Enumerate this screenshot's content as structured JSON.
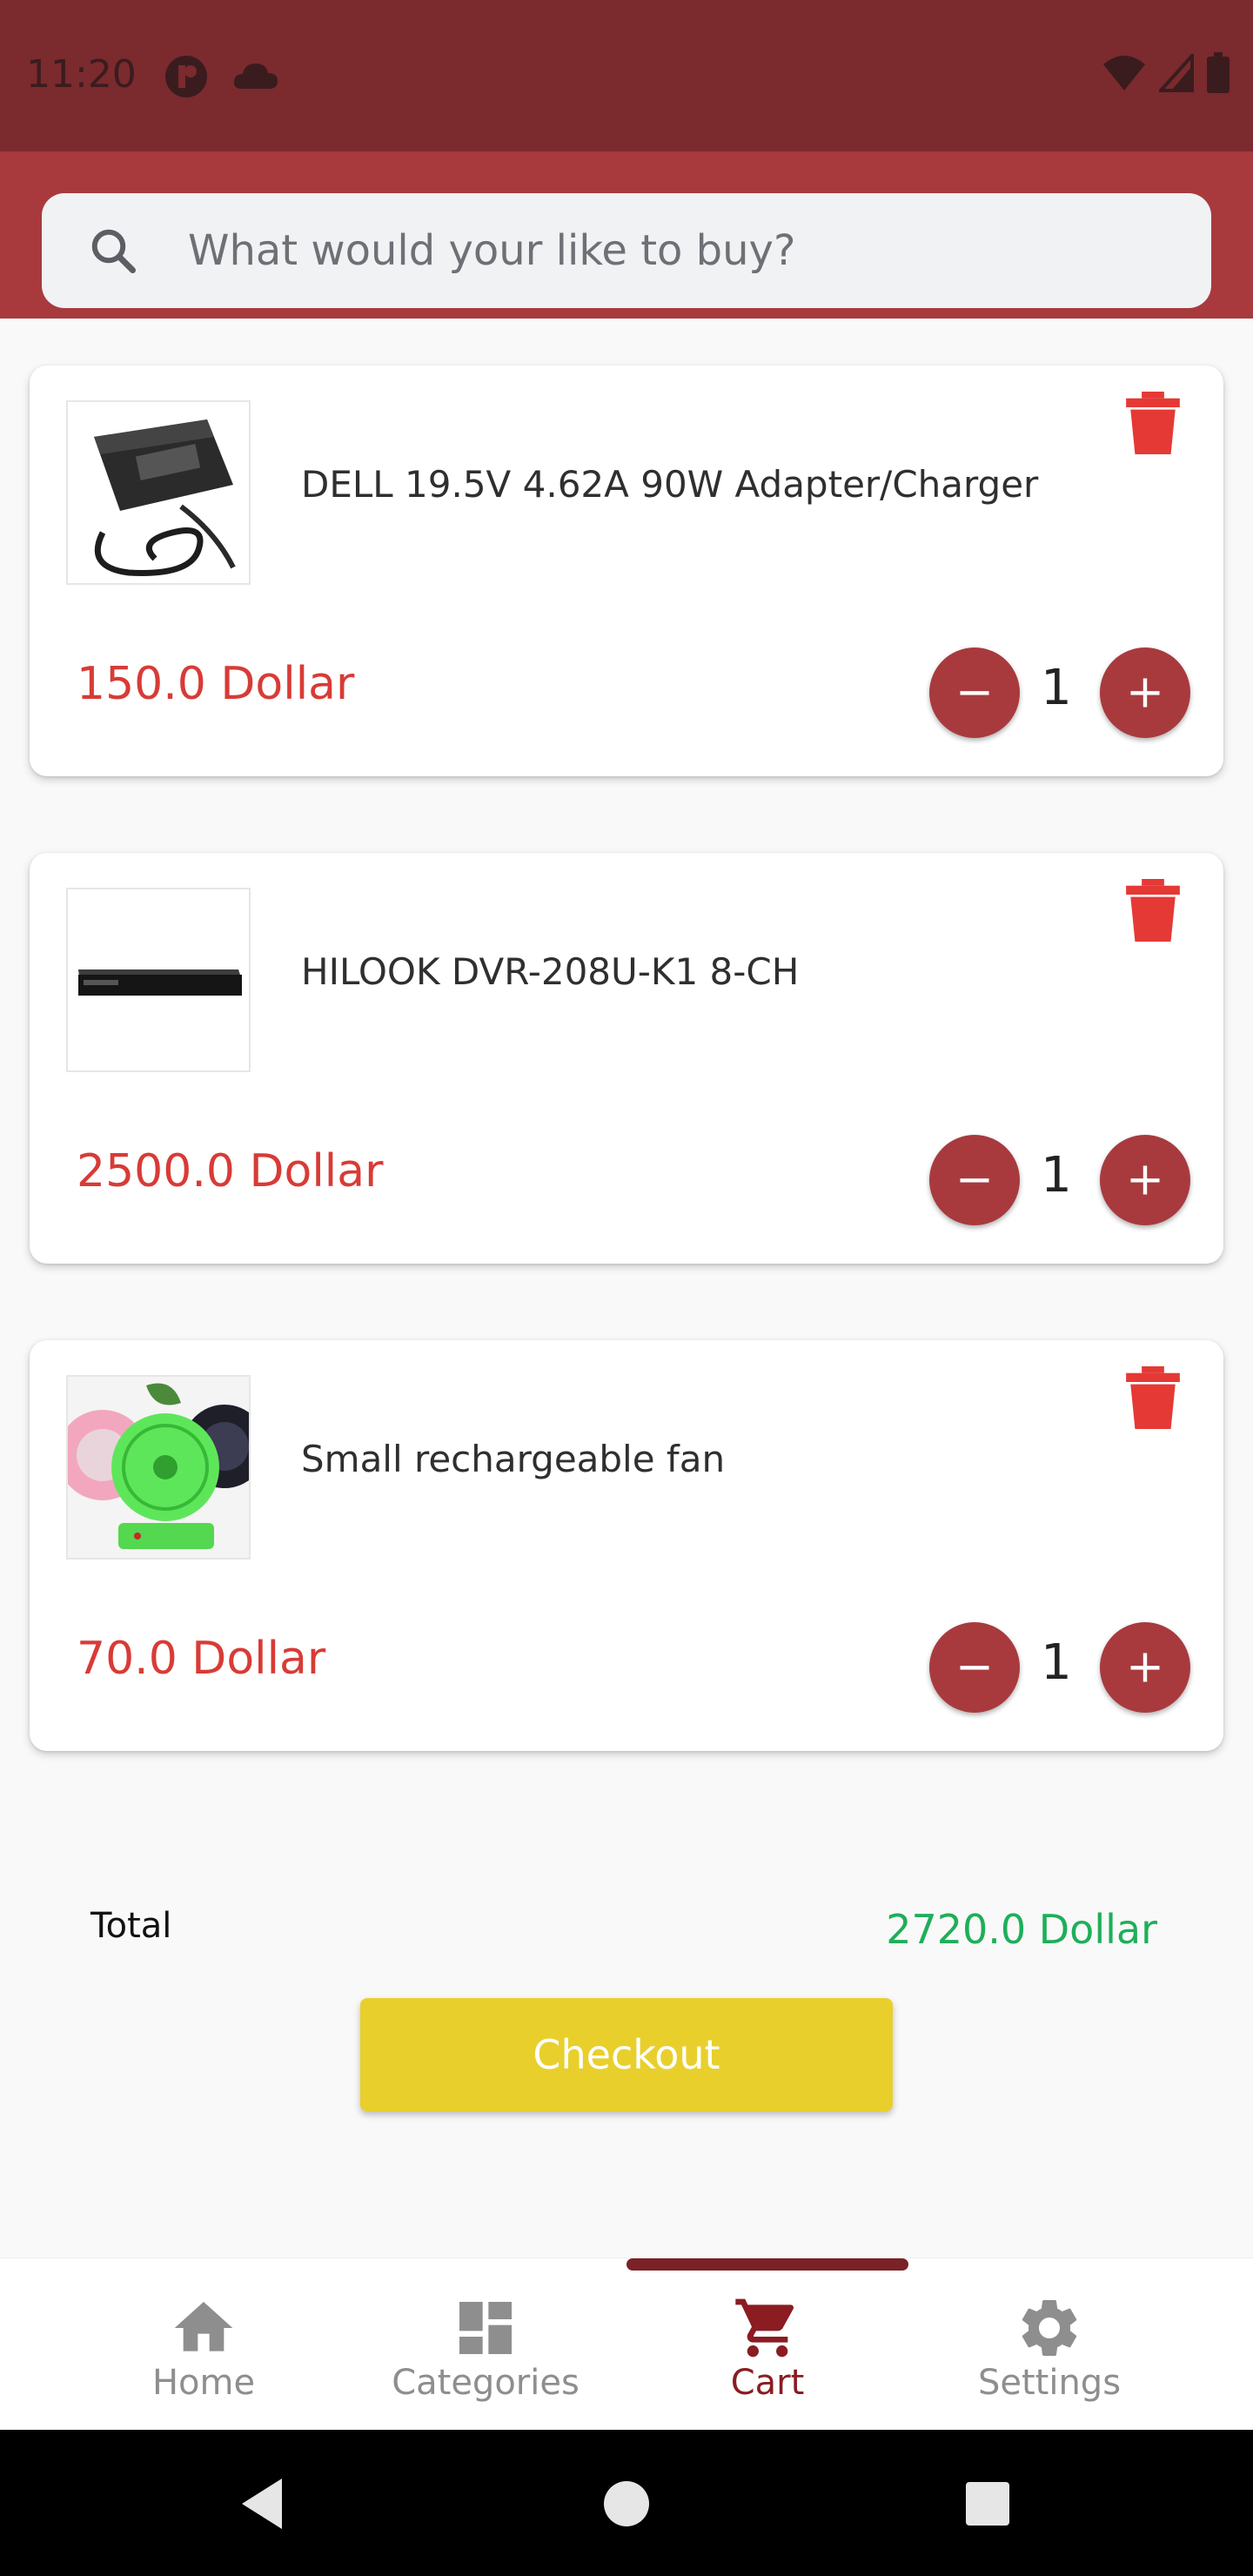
{
  "status_bar": {
    "time": "11:20"
  },
  "search": {
    "placeholder": "What would your like to buy?"
  },
  "cart_items": [
    {
      "name": "DELL 19.5V 4.62A 90W Adapter/Charger",
      "price": "150.0 Dollar",
      "quantity": "1",
      "image": "laptop-charger-image"
    },
    {
      "name": "HILOOK DVR-208U-K1 8-CH",
      "price": "2500.0 Dollar",
      "quantity": "1",
      "image": "dvr-recorder-image"
    },
    {
      "name": "Small rechargeable fan",
      "price": "70.0 Dollar",
      "quantity": "1",
      "image": "fan-image"
    }
  ],
  "summary": {
    "total_label": "Total",
    "total_value": "2720.0 Dollar",
    "checkout_label": "Checkout"
  },
  "bottom_nav": {
    "items": [
      {
        "label": "Home",
        "icon": "home-icon"
      },
      {
        "label": "Categories",
        "icon": "dashboard-icon"
      },
      {
        "label": "Cart",
        "icon": "cart-icon",
        "active": true
      },
      {
        "label": "Settings",
        "icon": "gear-icon"
      }
    ]
  },
  "colors": {
    "status_bar": "#7b2a2e",
    "app_bar": "#a83a3e",
    "price": "#d83b36",
    "total": "#1fae5a",
    "checkout": "#e9cf2c",
    "active_nav": "#8a1c22"
  }
}
